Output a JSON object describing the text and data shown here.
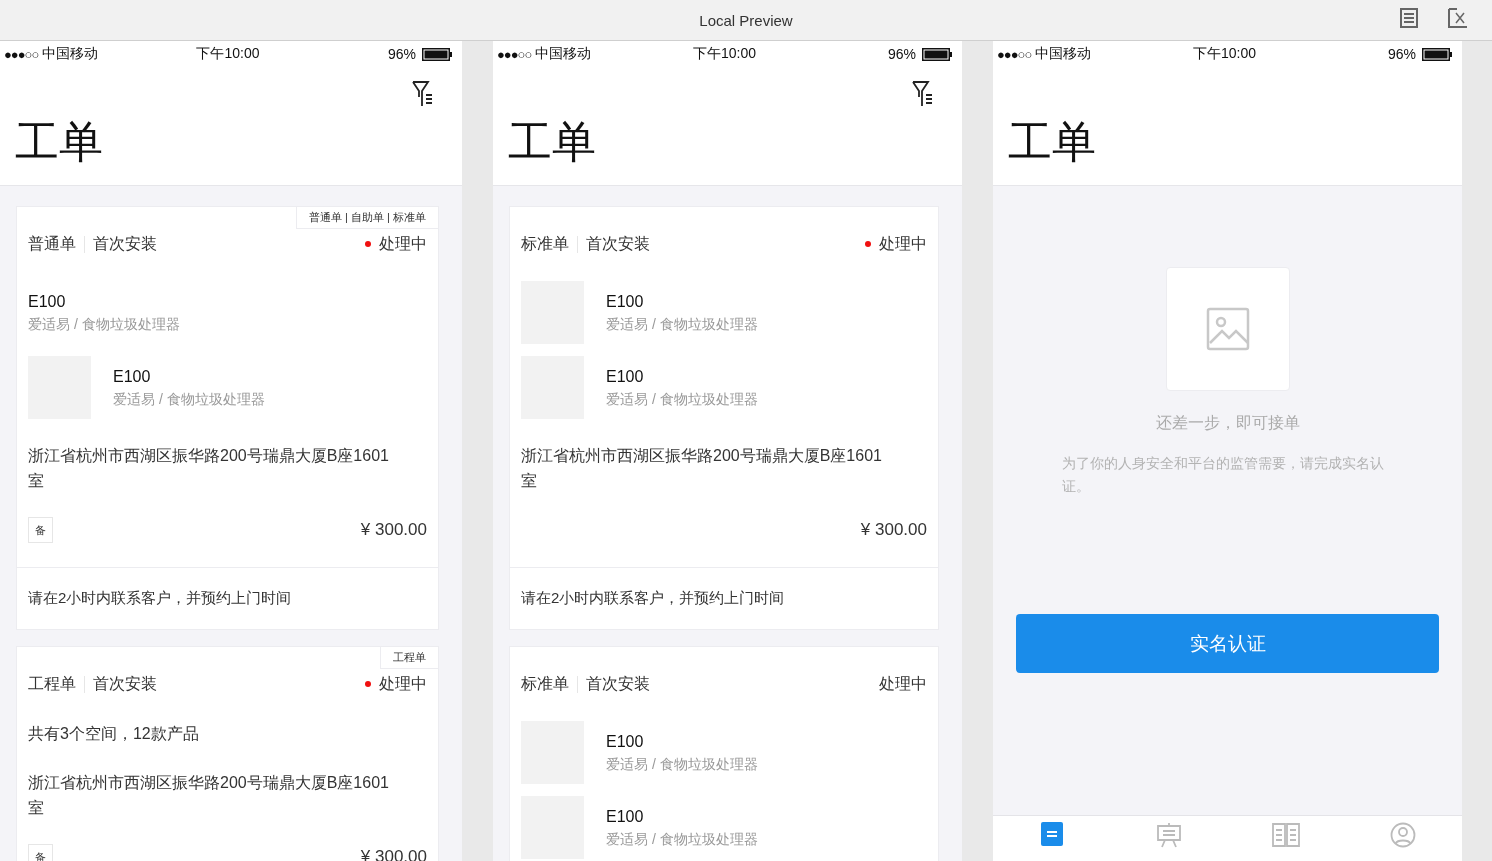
{
  "window": {
    "title": "Local Preview"
  },
  "screens": [
    {
      "status_bar": {
        "signal": "●●●○○",
        "carrier": "中国移动",
        "time": "下午10:00",
        "battery": "96%"
      },
      "title": "工单",
      "filter_button": true,
      "orders": [
        {
          "tags": "普通单 | 自助单 | 标准单",
          "type": "普通单",
          "service": "首次安装",
          "status": "处理中",
          "status_dot": true,
          "products": [
            {
              "image": false,
              "name": "E100",
              "category": "爱适易 / 食物垃圾处理器"
            },
            {
              "image": true,
              "name": "E100",
              "category": "爱适易 / 食物垃圾处理器"
            }
          ],
          "address": "浙江省杭州市西湖区振华路200号瑞鼎大厦B座1601室",
          "remark": "备",
          "price": "¥ 300.00",
          "notice": "请在2小时内联系客户，并预约上门时间"
        },
        {
          "tags": "工程单",
          "type": "工程单",
          "service": "首次安装",
          "status": "处理中",
          "status_dot": true,
          "summary": "共有3个空间，12款产品",
          "address": "浙江省杭州市西湖区振华路200号瑞鼎大厦B座1601室",
          "remark": "备",
          "price": "¥ 300.00"
        }
      ]
    },
    {
      "status_bar": {
        "signal": "●●●○○",
        "carrier": "中国移动",
        "time": "下午10:00",
        "battery": "96%"
      },
      "title": "工单",
      "filter_button": true,
      "orders": [
        {
          "type": "标准单",
          "service": "首次安装",
          "status": "处理中",
          "status_dot": true,
          "products": [
            {
              "image": true,
              "name": "E100",
              "category": "爱适易 / 食物垃圾处理器"
            },
            {
              "image": true,
              "name": "E100",
              "category": "爱适易 / 食物垃圾处理器"
            }
          ],
          "address": "浙江省杭州市西湖区振华路200号瑞鼎大厦B座1601室",
          "price": "¥ 300.00",
          "notice": "请在2小时内联系客户，并预约上门时间"
        },
        {
          "type": "标准单",
          "service": "首次安装",
          "status": "处理中",
          "status_dot": false,
          "products": [
            {
              "image": true,
              "name": "E100",
              "category": "爱适易 / 食物垃圾处理器"
            },
            {
              "image": true,
              "name": "E100",
              "category": "爱适易 / 食物垃圾处理器"
            }
          ]
        }
      ]
    },
    {
      "status_bar": {
        "signal": "●●●○○",
        "carrier": "中国移动",
        "time": "下午10:00",
        "battery": "96%"
      },
      "title": "工单",
      "filter_button": false,
      "empty_state": {
        "heading": "还差一步，即可接单",
        "description": "为了你的人身安全和平台的监管需要，请完成实名认证。",
        "button": "实名认证"
      },
      "tab_bar": [
        {
          "kind": "orders",
          "selected": true
        },
        {
          "kind": "training",
          "selected": false
        },
        {
          "kind": "study",
          "selected": false
        },
        {
          "kind": "profile",
          "selected": false
        }
      ]
    }
  ]
}
